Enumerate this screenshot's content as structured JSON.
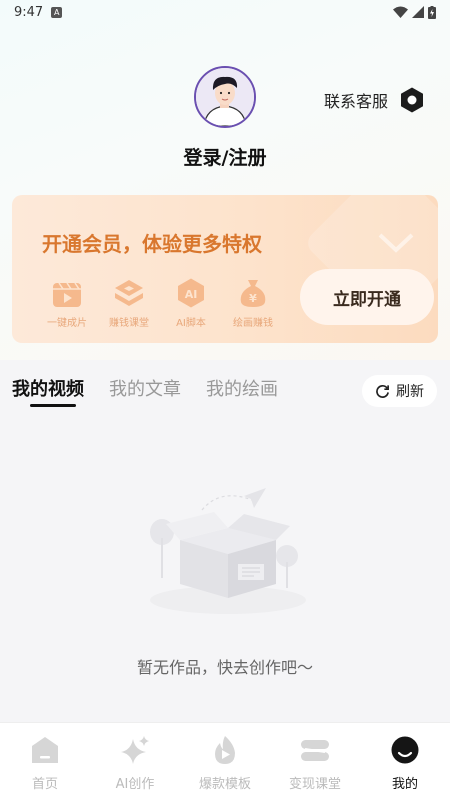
{
  "status_bar": {
    "time": "9:47",
    "badge": "A"
  },
  "header": {
    "login_label": "登录/注册",
    "service_label": "联系客服",
    "avatar_icon": "user-avatar-icon",
    "settings_icon": "hexagon-settings-icon"
  },
  "vip_card": {
    "title": "开通会员，体验更多特权",
    "button_label": "立即开通",
    "perks": [
      {
        "label": "一键成片",
        "icon": "clapper-icon"
      },
      {
        "label": "赚钱课堂",
        "icon": "layers-icon"
      },
      {
        "label": "AI脚本",
        "icon": "ai-badge-icon"
      },
      {
        "label": "绘画赚钱",
        "icon": "money-bag-icon"
      }
    ]
  },
  "tabs": [
    {
      "label": "我的视频",
      "active": true
    },
    {
      "label": "我的文章",
      "active": false
    },
    {
      "label": "我的绘画",
      "active": false
    }
  ],
  "refresh_label": "刷新",
  "empty_text": "暂无作品，快去创作吧～",
  "bottom_nav": [
    {
      "label": "首页",
      "icon": "home-icon",
      "active": false
    },
    {
      "label": "AI创作",
      "icon": "sparkle-icon",
      "active": false
    },
    {
      "label": "爆款模板",
      "icon": "flame-play-icon",
      "active": false
    },
    {
      "label": "变现课堂",
      "icon": "stack-icon",
      "active": false
    },
    {
      "label": "我的",
      "icon": "profile-face-icon",
      "active": true
    }
  ],
  "colors": {
    "vip_title": "#d9772e",
    "perk_icon": "#f5b98d",
    "nav_inactive": "#d6d6d6",
    "nav_active": "#111111"
  }
}
